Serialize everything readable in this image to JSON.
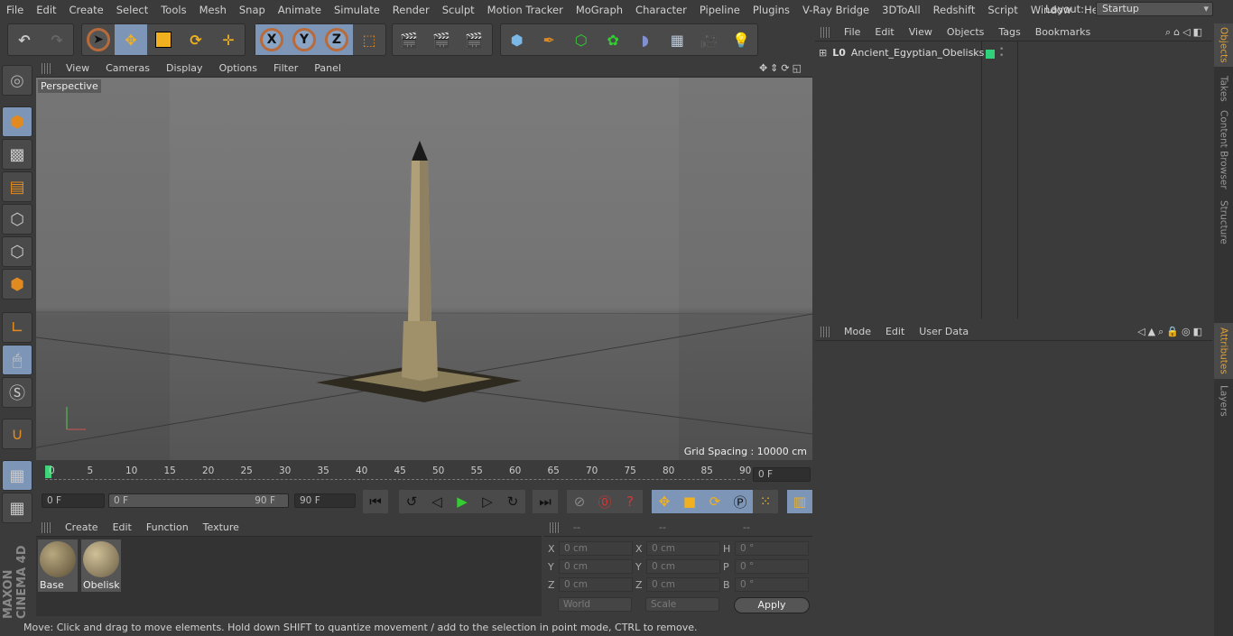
{
  "menu": [
    "File",
    "Edit",
    "Create",
    "Select",
    "Tools",
    "Mesh",
    "Snap",
    "Animate",
    "Simulate",
    "Render",
    "Sculpt",
    "Motion Tracker",
    "MoGraph",
    "Character",
    "Pipeline",
    "Plugins",
    "V-Ray Bridge",
    "3DToAll",
    "Redshift",
    "Script",
    "Window",
    "Help"
  ],
  "layout": {
    "label": "Layout:",
    "value": "Startup"
  },
  "viewport": {
    "menu": [
      "View",
      "Cameras",
      "Display",
      "Options",
      "Filter",
      "Panel"
    ],
    "label": "Perspective",
    "grid_spacing": "Grid Spacing : 10000 cm"
  },
  "timeline": {
    "ticks": [
      "0",
      "5",
      "10",
      "15",
      "20",
      "25",
      "30",
      "35",
      "40",
      "45",
      "50",
      "55",
      "60",
      "65",
      "70",
      "75",
      "80",
      "85",
      "90"
    ],
    "current": "0 F",
    "start": "0 F",
    "range_start": "0 F",
    "range_end": "90 F",
    "end": "90 F"
  },
  "materials": {
    "menu": [
      "Create",
      "Edit",
      "Function",
      "Texture"
    ],
    "items": [
      "Base",
      "Obelisk"
    ]
  },
  "coords": {
    "headers": [
      "--",
      "--",
      "--"
    ],
    "rows": [
      [
        "X",
        "0 cm",
        "X",
        "0 cm",
        "H",
        "0 °"
      ],
      [
        "Y",
        "0 cm",
        "Y",
        "0 cm",
        "P",
        "0 °"
      ],
      [
        "Z",
        "0 cm",
        "Z",
        "0 cm",
        "B",
        "0 °"
      ]
    ],
    "mode": "World",
    "scale": "Scale",
    "apply": "Apply"
  },
  "status": "Move: Click and drag to move elements. Hold down SHIFT to quantize movement / add to the selection in point mode, CTRL to remove.",
  "objects": {
    "menu": [
      "File",
      "Edit",
      "View",
      "Objects",
      "Tags",
      "Bookmarks"
    ],
    "items": [
      {
        "name": "Ancient_Egyptian_Obelisks",
        "color": "#2fd17a"
      }
    ]
  },
  "attributes": {
    "menu": [
      "Mode",
      "Edit",
      "User Data"
    ]
  },
  "right_tabs": [
    "Objects",
    "Takes",
    "Content Browser",
    "Structure",
    "Attributes",
    "Layers"
  ],
  "brand": "MAXON CINEMA 4D",
  "colors": {
    "accent": "#7d96b8",
    "playhead": "#3fd47a"
  }
}
